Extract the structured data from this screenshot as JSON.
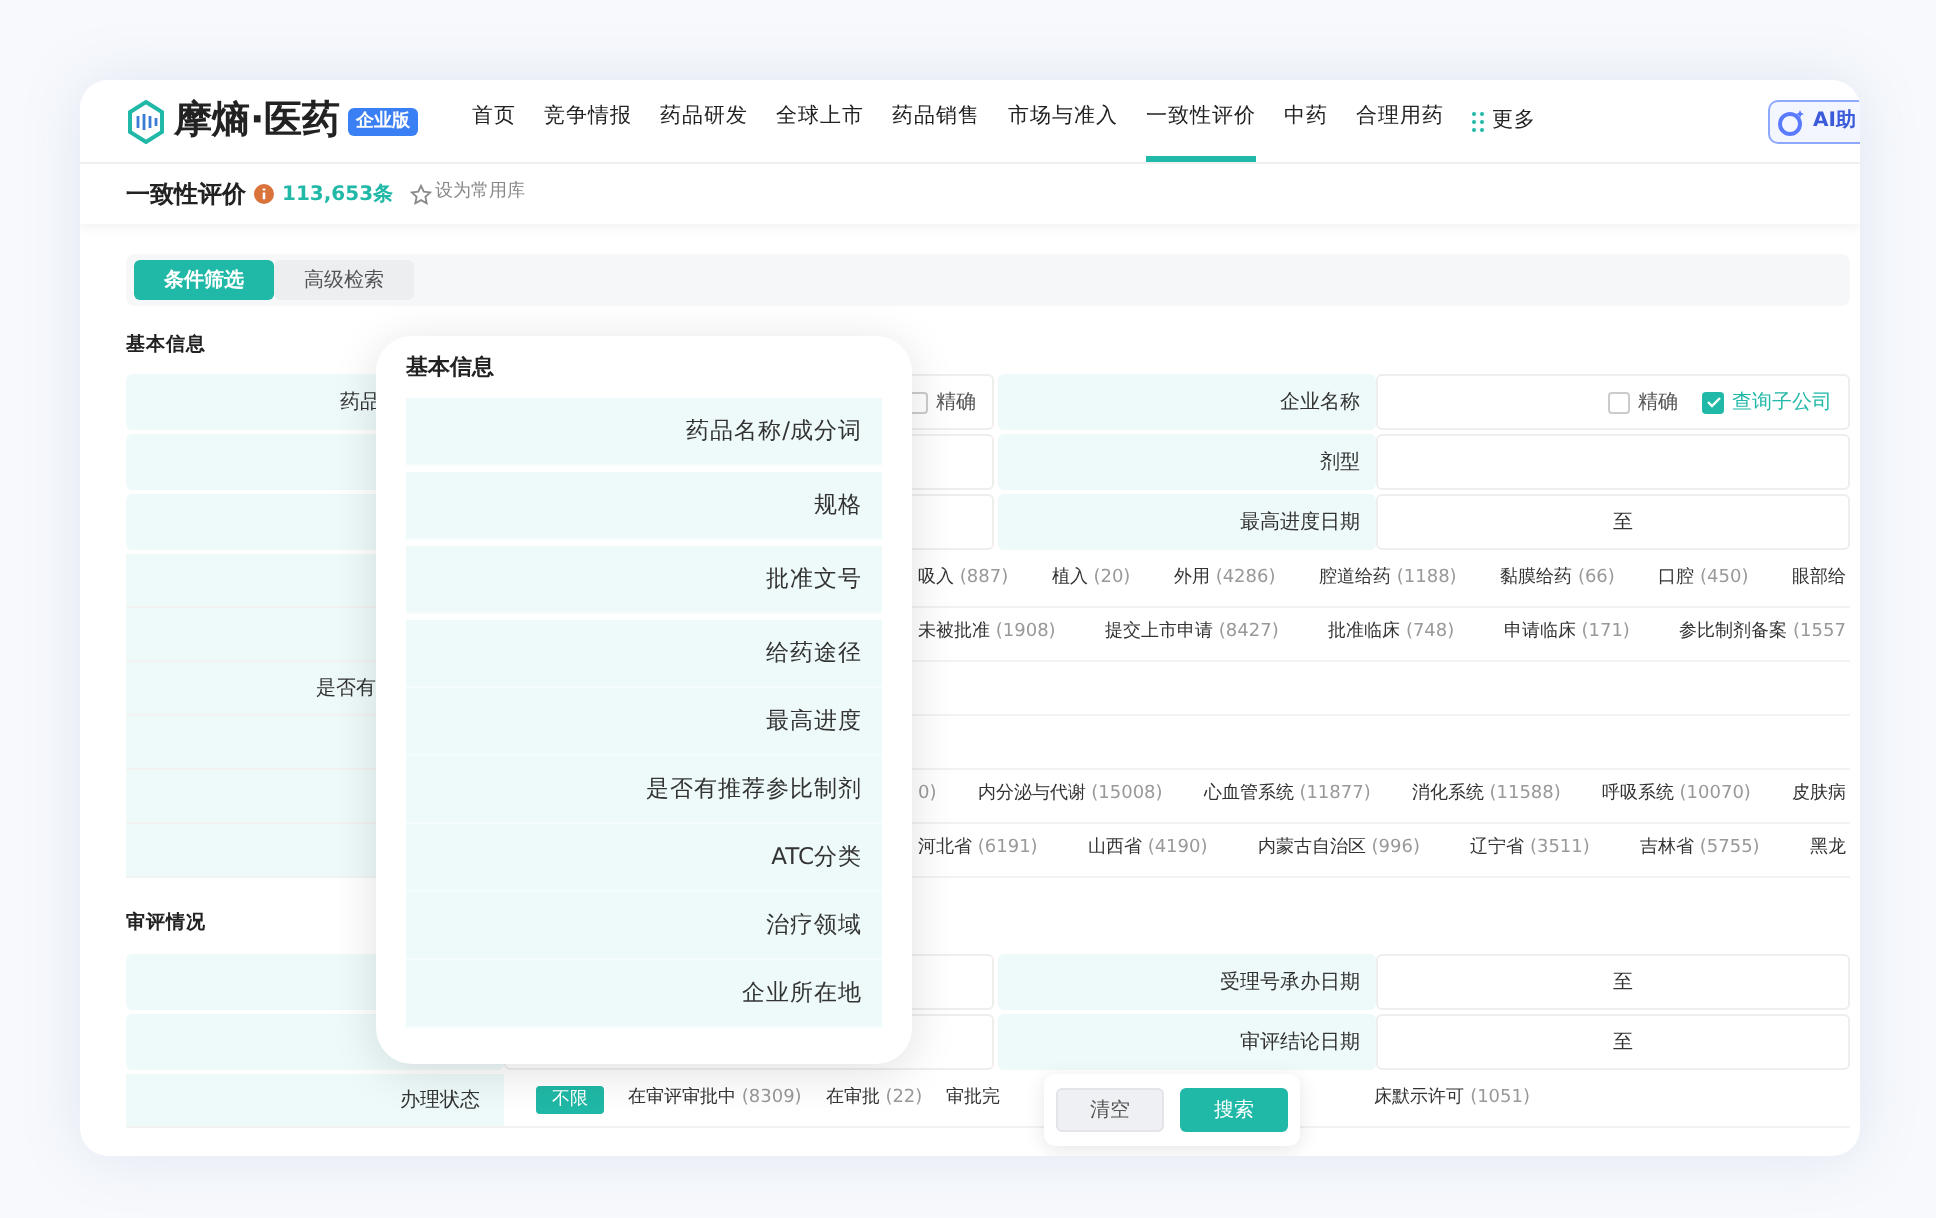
{
  "nav": {
    "logo_text": "摩熵·医药",
    "badge": "企业版",
    "items": [
      {
        "label": "首页",
        "selected": false
      },
      {
        "label": "竞争情报",
        "selected": false
      },
      {
        "label": "药品研发",
        "selected": false
      },
      {
        "label": "全球上市",
        "selected": false
      },
      {
        "label": "药品销售",
        "selected": false
      },
      {
        "label": "市场与准入",
        "selected": false
      },
      {
        "label": "一致性评价",
        "selected": true
      },
      {
        "label": "中药",
        "selected": false
      },
      {
        "label": "合理用药",
        "selected": false
      }
    ],
    "more": "更多",
    "ai_button": "AI助"
  },
  "page_header": {
    "title": "一致性评价",
    "count": "113,653条",
    "favorite": "设为常用库"
  },
  "tabs": [
    {
      "label": "条件筛选",
      "selected": true
    },
    {
      "label": "高级检索",
      "selected": false
    }
  ],
  "basic_info": {
    "title": "基本信息",
    "rows": [
      {
        "kind": "pair",
        "left": {
          "label": "药品",
          "checkboxes": [
            {
              "label": "精确",
              "checked": false
            }
          ]
        },
        "right": {
          "label": "企业名称",
          "checkboxes": [
            {
              "label": "精确",
              "checked": false
            },
            {
              "label": "查询子公司",
              "checked": true
            }
          ]
        }
      },
      {
        "kind": "pair",
        "left": {},
        "right": {
          "label": "剂型"
        }
      },
      {
        "kind": "pair",
        "left": {},
        "right": {
          "label": "最高进度日期",
          "range_separator": "至"
        }
      }
    ],
    "tag_rows": [
      {
        "kind": "tags",
        "tags": [
          {
            "label": "吸入",
            "count": "(887)"
          },
          {
            "label": "植入",
            "count": "(20)"
          },
          {
            "label": "外用",
            "count": "(4286)"
          },
          {
            "label": "腔道给药",
            "count": "(1188)"
          },
          {
            "label": "黏膜给药",
            "count": "(66)"
          },
          {
            "label": "口腔",
            "count": "(450)"
          },
          {
            "label": "眼部给"
          }
        ]
      },
      {
        "kind": "tags",
        "tags": [
          {
            "label": "未被批准",
            "count": "(1908)"
          },
          {
            "label": "提交上市申请",
            "count": "(8427)"
          },
          {
            "label": "批准临床",
            "count": "(748)"
          },
          {
            "label": "申请临床",
            "count": "(171)"
          },
          {
            "label": "参比制剂备案",
            "count": "(1557"
          }
        ]
      },
      {
        "kind": "label",
        "label": "是否有"
      },
      {
        "kind": "blank"
      },
      {
        "kind": "tags",
        "tags": [
          {
            "count": "0)"
          },
          {
            "label": "内分泌与代谢",
            "count": "(15008)"
          },
          {
            "label": "心血管系统",
            "count": "(11877)"
          },
          {
            "label": "消化系统",
            "count": "(11588)"
          },
          {
            "label": "呼吸系统",
            "count": "(10070)"
          },
          {
            "label": "皮肤病"
          }
        ]
      },
      {
        "kind": "tags",
        "tags": [
          {
            "label": "河北省",
            "count": "(6191)"
          },
          {
            "label": "山西省",
            "count": "(4190)"
          },
          {
            "label": "内蒙古自治区",
            "count": "(996)"
          },
          {
            "label": "辽宁省",
            "count": "(3511)"
          },
          {
            "label": "吉林省",
            "count": "(5755)"
          },
          {
            "label": "黑龙"
          }
        ]
      }
    ]
  },
  "review": {
    "title": "审评情况",
    "rows": [
      {
        "kind": "pair",
        "left": {},
        "right": {
          "label": "受理号承办日期",
          "range_separator": "至"
        }
      },
      {
        "kind": "pair",
        "left": {},
        "right": {
          "label": "审评结论日期",
          "range_separator": "至"
        }
      }
    ],
    "status": {
      "label": "办理状态",
      "options": [
        {
          "label": "不限",
          "selected": true
        },
        {
          "label": "在审评审批中",
          "count": "(8309)",
          "selected": false
        },
        {
          "label": "在审批",
          "count": "(22)",
          "selected": false
        },
        {
          "label": "审批完",
          "selected": false
        },
        {
          "label": "床默示许可",
          "count": "(1051)",
          "selected": false
        }
      ]
    }
  },
  "popup": {
    "title": "基本信息",
    "groups": [
      [
        "药品名称/成分词"
      ],
      [
        "规格"
      ],
      [
        "批准文号"
      ],
      [
        "给药途径",
        "最高进度",
        "是否有推荐参比制剂",
        "ATC分类",
        "治疗领域",
        "企业所在地"
      ]
    ]
  },
  "buttons": [
    {
      "label": "清空",
      "kind": "secondary"
    },
    {
      "label": "搜索",
      "kind": "primary"
    }
  ]
}
